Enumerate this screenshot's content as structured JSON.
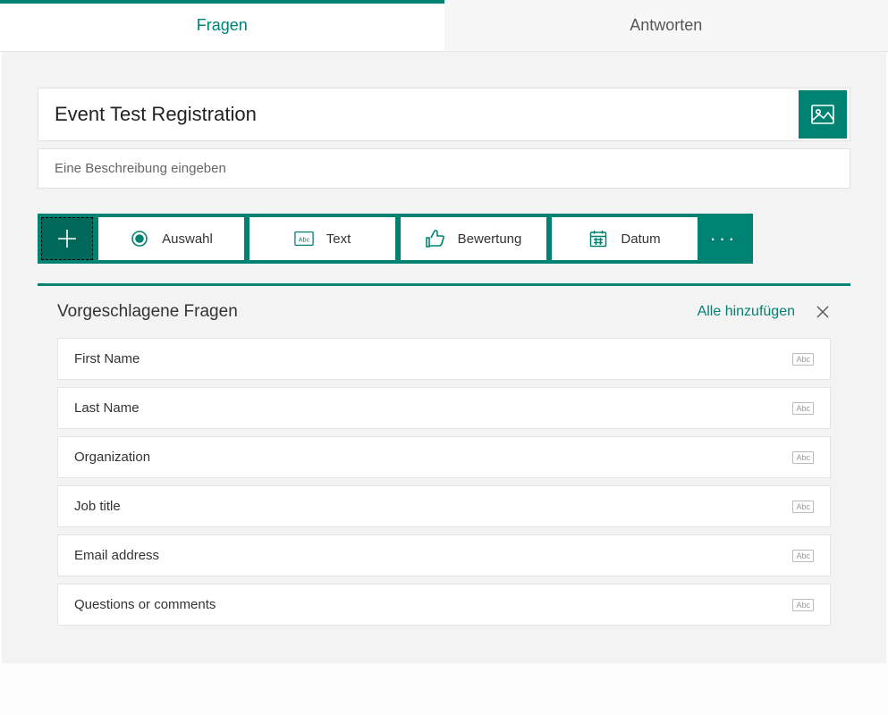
{
  "tabs": {
    "questions": "Fragen",
    "answers": "Antworten"
  },
  "form": {
    "title": "Event Test Registration",
    "description_placeholder": "Eine Beschreibung eingeben"
  },
  "toolbar": {
    "choice": "Auswahl",
    "text": "Text",
    "rating": "Bewertung",
    "date": "Datum"
  },
  "suggested": {
    "title": "Vorgeschlagene Fragen",
    "add_all": "Alle hinzufügen",
    "type_badge": "Abc",
    "items": [
      {
        "label": "First Name"
      },
      {
        "label": "Last Name"
      },
      {
        "label": "Organization"
      },
      {
        "label": "Job title"
      },
      {
        "label": "Email address"
      },
      {
        "label": "Questions or comments"
      }
    ]
  }
}
